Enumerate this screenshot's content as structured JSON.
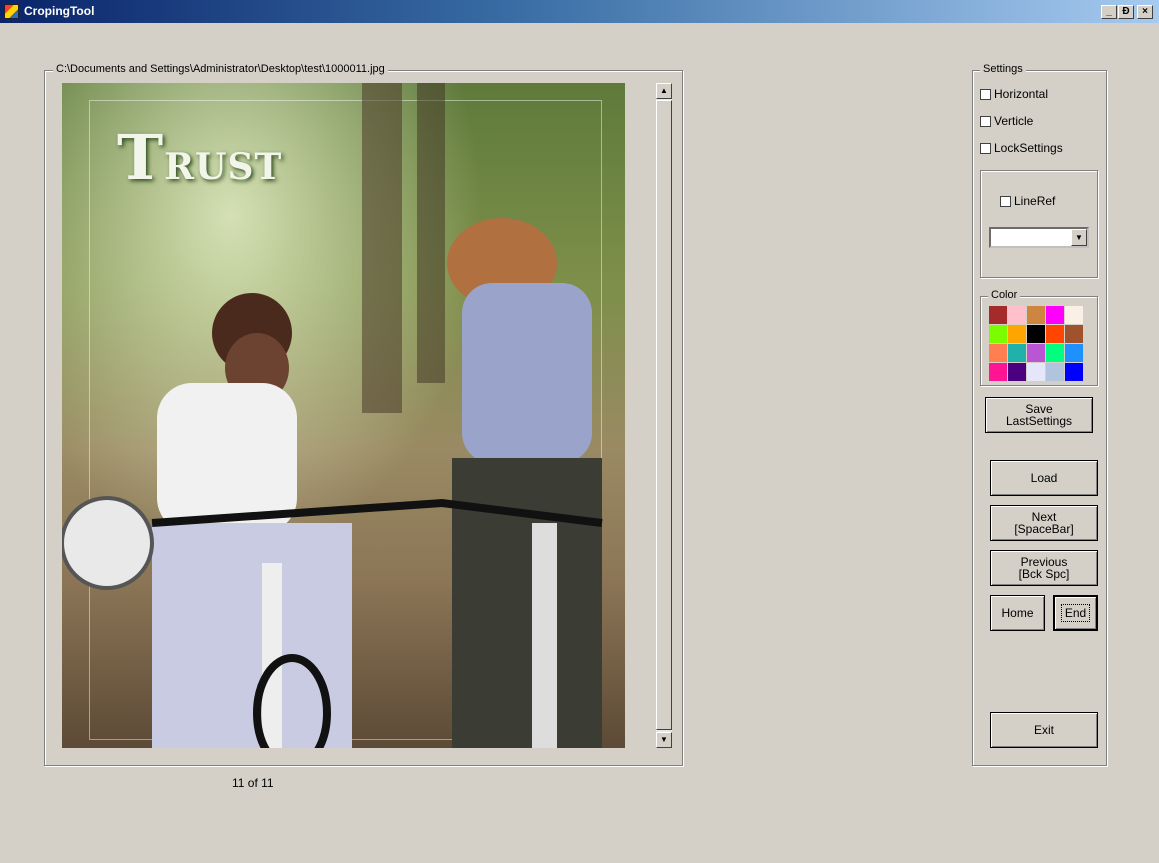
{
  "window": {
    "title": "CropingTool",
    "controls": {
      "minimize": "_",
      "restore": "Đ",
      "close": "×"
    }
  },
  "image_panel": {
    "file_path": "C:\\Documents and Settings\\Administrator\\Desktop\\test\\1000011.jpg",
    "photo_text_big": "T",
    "photo_text_small": "RUST",
    "counter": "11 of 11"
  },
  "settings": {
    "label": "Settings",
    "checkboxes": [
      {
        "label": "Horizontal",
        "checked": false
      },
      {
        "label": "Verticle",
        "checked": false
      },
      {
        "label": "LockSettings",
        "checked": false
      }
    ],
    "lineref": {
      "label": "LineRef",
      "checked": false,
      "selected_value": ""
    },
    "color": {
      "label": "Color",
      "swatches": [
        "#a52a2a",
        "#ffc0cb",
        "#cd853f",
        "#ff00ff",
        "#faf0e6",
        "#7cfc00",
        "#ffa500",
        "#000000",
        "#ff4500",
        "#a0522d",
        "#ff7f50",
        "#20b2aa",
        "#ba55d3",
        "#00ff7f",
        "#1e90ff",
        "#ff1493",
        "#4b0082",
        "#e6e6fa",
        "#b0c4de",
        "#0000ff"
      ]
    },
    "buttons": {
      "save_last_settings": "Save\nLastSettings",
      "load": "Load",
      "next": "Next\n[SpaceBar]",
      "previous": "Previous\n[Bck Spc]",
      "home": "Home",
      "end": "End",
      "exit": "Exit"
    }
  }
}
